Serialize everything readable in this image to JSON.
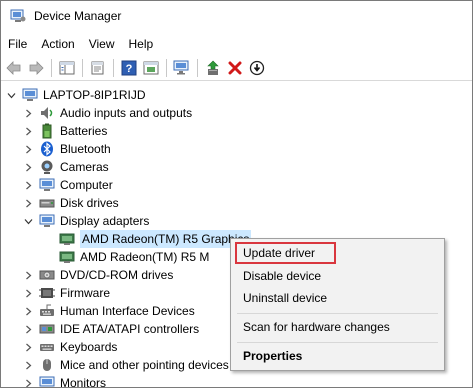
{
  "window": {
    "title": "Device Manager"
  },
  "menu": [
    "File",
    "Action",
    "View",
    "Help"
  ],
  "toolbar": {
    "buttons": [
      "back-icon",
      "forward-icon",
      "show-hide-console-tree-icon",
      "properties-icon",
      "help-icon",
      "action-pane-icon",
      "scan-hardware-icon",
      "update-driver-icon",
      "uninstall-icon",
      "disable-icon"
    ],
    "colors": {
      "arrow": "#4a6ab0",
      "green": "#2e9a3a",
      "red": "#d11a1a",
      "uninstall_red": "#d11a1a"
    }
  },
  "tree": {
    "root": "LAPTOP-8IP1RIJD",
    "items": [
      {
        "label": "Audio inputs and outputs",
        "icon": "speaker-icon",
        "expanded": false
      },
      {
        "label": "Batteries",
        "icon": "battery-icon",
        "expanded": false
      },
      {
        "label": "Bluetooth",
        "icon": "bluetooth-icon",
        "expanded": false
      },
      {
        "label": "Cameras",
        "icon": "camera-icon",
        "expanded": false
      },
      {
        "label": "Computer",
        "icon": "computer-icon",
        "expanded": false
      },
      {
        "label": "Disk drives",
        "icon": "disk-drive-icon",
        "expanded": false
      },
      {
        "label": "Display adapters",
        "icon": "display-adapter-icon",
        "expanded": true
      },
      {
        "label": "AMD Radeon(TM) R5 Graphics",
        "icon": "display-adapter-icon",
        "child": true,
        "selected": true
      },
      {
        "label": "AMD Radeon(TM) R5 M",
        "icon": "display-adapter-icon",
        "child": true
      },
      {
        "label": "DVD/CD-ROM drives",
        "icon": "dvd-icon",
        "expanded": false
      },
      {
        "label": "Firmware",
        "icon": "firmware-icon",
        "expanded": false
      },
      {
        "label": "Human Interface Devices",
        "icon": "hid-icon",
        "expanded": false
      },
      {
        "label": "IDE ATA/ATAPI controllers",
        "icon": "ide-controller-icon",
        "expanded": false
      },
      {
        "label": "Keyboards",
        "icon": "keyboard-icon",
        "expanded": false
      },
      {
        "label": "Mice and other pointing devices",
        "icon": "mouse-icon",
        "expanded": false
      },
      {
        "label": "Monitors",
        "icon": "monitor-icon",
        "expanded": false
      }
    ]
  },
  "context_menu": {
    "items": [
      {
        "label": "Update driver",
        "highlighted": true
      },
      {
        "label": "Disable device"
      },
      {
        "label": "Uninstall device"
      },
      {
        "label": "Scan for hardware changes"
      },
      {
        "label": "Properties",
        "bold": true
      }
    ],
    "highlight_color": "#d9363e"
  },
  "colors": {
    "selection": "#cce8ff",
    "menu_bg": "#f2f2f2"
  }
}
